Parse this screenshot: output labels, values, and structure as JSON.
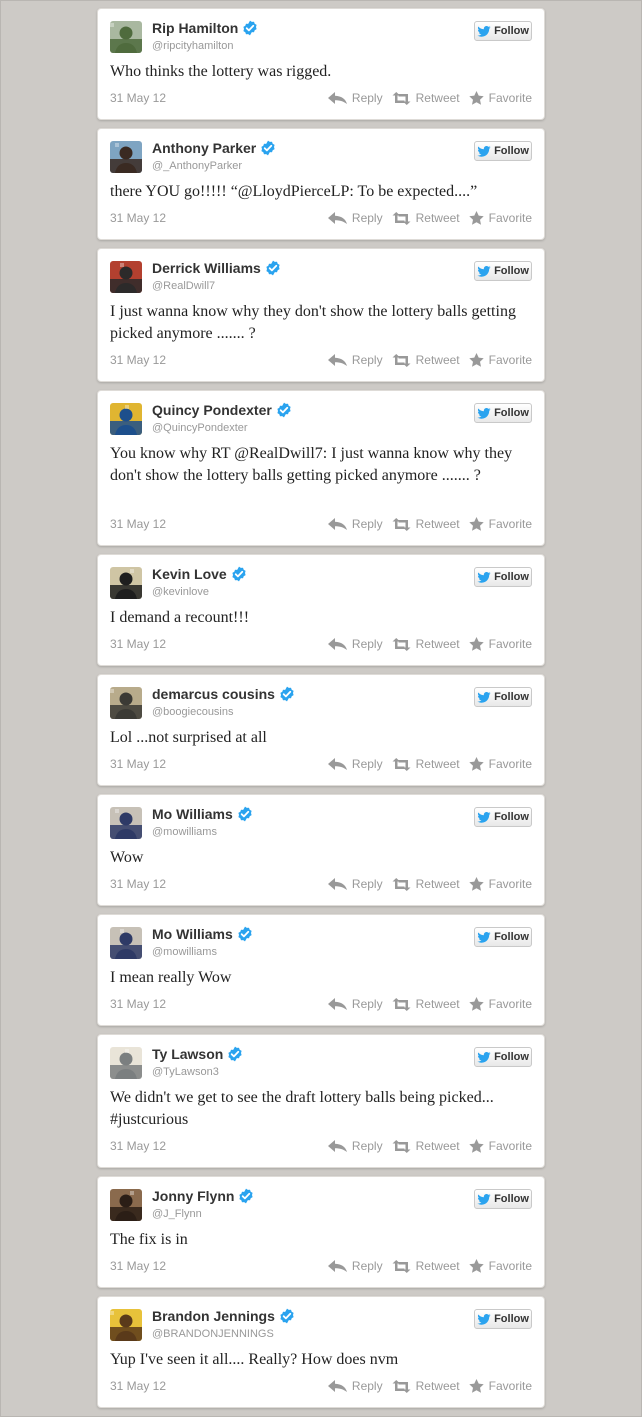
{
  "follow_label": "Follow",
  "actions": {
    "reply": "Reply",
    "retweet": "Retweet",
    "favorite": "Favorite"
  },
  "colors": {
    "page_bg": "#cdcac6",
    "verified": "#2aa3ef",
    "bird": "#2aa3ef",
    "action_gray": "#999999"
  },
  "tweets": [
    {
      "name": "Rip Hamilton",
      "handle": "@ripcityhamilton",
      "text": "Who thinks the lottery was rigged.",
      "date": "31 May 12",
      "avatar": [
        "#4f6b3d",
        "#a9b8a0"
      ]
    },
    {
      "name": "Anthony Parker",
      "handle": "@_AnthonyParker",
      "text": "there YOU go!!!!! “@LloydPierceLP: To be expected....”",
      "date": "31 May 12",
      "avatar": [
        "#3a2a22",
        "#7ea4c2"
      ]
    },
    {
      "name": "Derrick Williams",
      "handle": "@RealDwill7",
      "text": "I just wanna know why they don't show the lottery balls getting picked anymore ....... ?",
      "date": "31 May 12",
      "avatar": [
        "#2c2a2a",
        "#b3402f"
      ]
    },
    {
      "name": "Quincy Pondexter",
      "handle": "@QuincyPondexter",
      "text": "You know why RT @RealDwill7: I just wanna know why they don't show the lottery balls getting picked anymore ....... ?",
      "date": "31 May 12",
      "avatar": [
        "#1d4f8c",
        "#e0b531"
      ]
    },
    {
      "name": "Kevin Love",
      "handle": "@kevinlove",
      "text": "I demand a recount!!!",
      "date": "31 May 12",
      "avatar": [
        "#1e1e1e",
        "#cfc5a4"
      ]
    },
    {
      "name": "demarcus cousins",
      "handle": "@boogiecousins",
      "text": "Lol ...not surprised at all",
      "date": "31 May 12",
      "avatar": [
        "#3b3a35",
        "#b8ab8b"
      ]
    },
    {
      "name": "Mo Williams",
      "handle": "@mowilliams",
      "text": "Wow",
      "date": "31 May 12",
      "avatar": [
        "#2e3a66",
        "#c7c1b7"
      ]
    },
    {
      "name": "Mo Williams",
      "handle": "@mowilliams",
      "text": "I mean really Wow",
      "date": "31 May 12",
      "avatar": [
        "#2e3a66",
        "#c7c1b7"
      ]
    },
    {
      "name": "Ty Lawson",
      "handle": "@TyLawson3",
      "text": "We didn't we get to see the draft lottery balls being picked... #justcurious",
      "date": "31 May 12",
      "avatar": [
        "#7b7f80",
        "#e9e4d8"
      ]
    },
    {
      "name": "Jonny Flynn",
      "handle": "@J_Flynn",
      "text": "The fix is in",
      "date": "31 May 12",
      "avatar": [
        "#2b1e16",
        "#8a6a4d"
      ]
    },
    {
      "name": "Brandon Jennings",
      "handle": "@BRANDONJENNINGS",
      "text": "Yup I've seen it all.... Really? How does nvm",
      "date": "31 May 12",
      "avatar": [
        "#5a3a1a",
        "#e8c23a"
      ]
    }
  ]
}
